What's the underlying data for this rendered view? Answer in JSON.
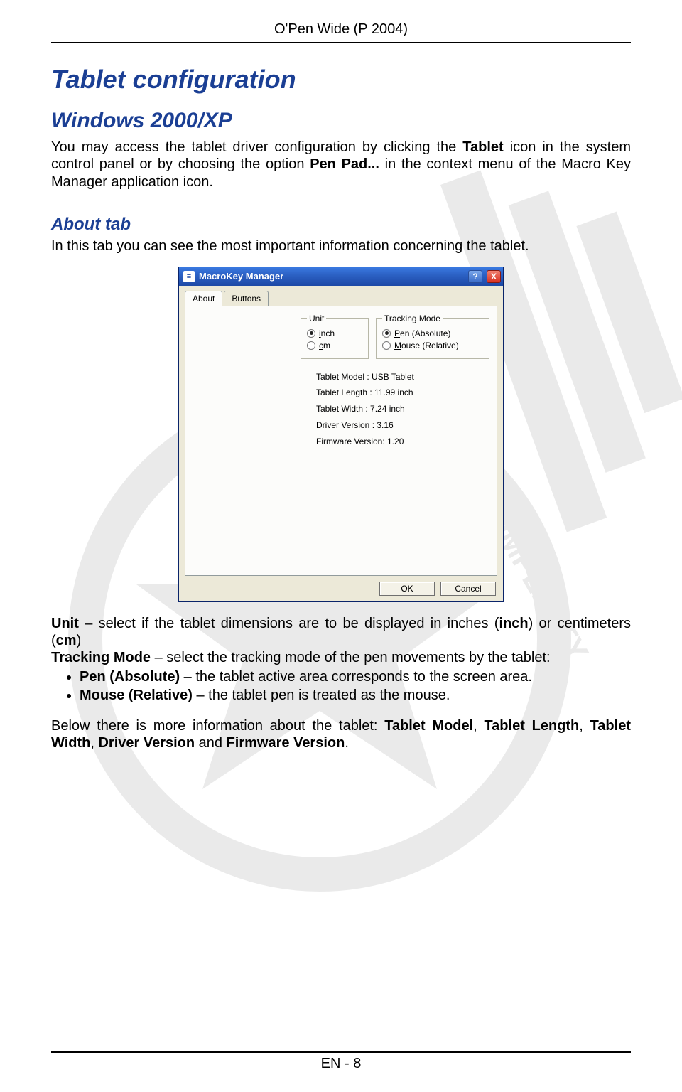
{
  "doc": {
    "header": "O'Pen Wide (P 2004)",
    "h1": "Tablet configuration",
    "h2": "Windows 2000/XP",
    "intro_1a": "You may access the tablet driver configuration by clicking the ",
    "intro_1b": "Tablet",
    "intro_1c": " icon in the system control panel or by choosing the option ",
    "intro_1d": "Pen Pad...",
    "intro_1e": " in the context menu of the Macro Key Manager application icon.",
    "h3": "About tab",
    "about_line": "In this tab you can see the most important information concerning the tablet.",
    "unit_line_a": "Unit",
    "unit_line_b": " – select if the tablet dimensions are to be displayed in inches (",
    "unit_line_c": "inch",
    "unit_line_d": ") or centimeters (",
    "unit_line_e": "cm",
    "unit_line_f": ")",
    "track_line_a": "Tracking Mode",
    "track_line_b": " – select the tracking mode of the pen movements by the tablet:",
    "bul1_a": "Pen (Absolute)",
    "bul1_b": " – the tablet active area corresponds to the screen area.",
    "bul2_a": "Mouse (Relative)",
    "bul2_b": " – the tablet pen is treated as the mouse.",
    "below_a": "Below there is more information about the tablet: ",
    "below_b": "Tablet Model",
    "below_c": ", ",
    "below_d": "Tablet Length",
    "below_e": ", ",
    "below_f": "Tablet Width",
    "below_g": ", ",
    "below_h": "Driver Version",
    "below_i": " and ",
    "below_j": "Firmware Version",
    "below_k": ".",
    "footer": "EN - 8"
  },
  "dialog": {
    "title": "MacroKey Manager",
    "help": "?",
    "close": "X",
    "tabs": {
      "about": "About",
      "buttons": "Buttons"
    },
    "unit": {
      "legend": "Unit",
      "inch_u": "i",
      "inch_r": "nch",
      "cm_u": "c",
      "cm_r": "m"
    },
    "track": {
      "legend": "Tracking Mode",
      "pen_u": "P",
      "pen_r": "en (Absolute)",
      "mouse_u": "M",
      "mouse_r": "ouse (Relative)"
    },
    "info": {
      "model": "Tablet Model : USB Tablet",
      "length": "Tablet Length : 11.99 inch",
      "width": "Tablet Width : 7.24 inch",
      "driver": "Driver Version : 3.16",
      "firmware": "Firmware Version: 1.20"
    },
    "ok": "OK",
    "cancel": "Cancel"
  }
}
